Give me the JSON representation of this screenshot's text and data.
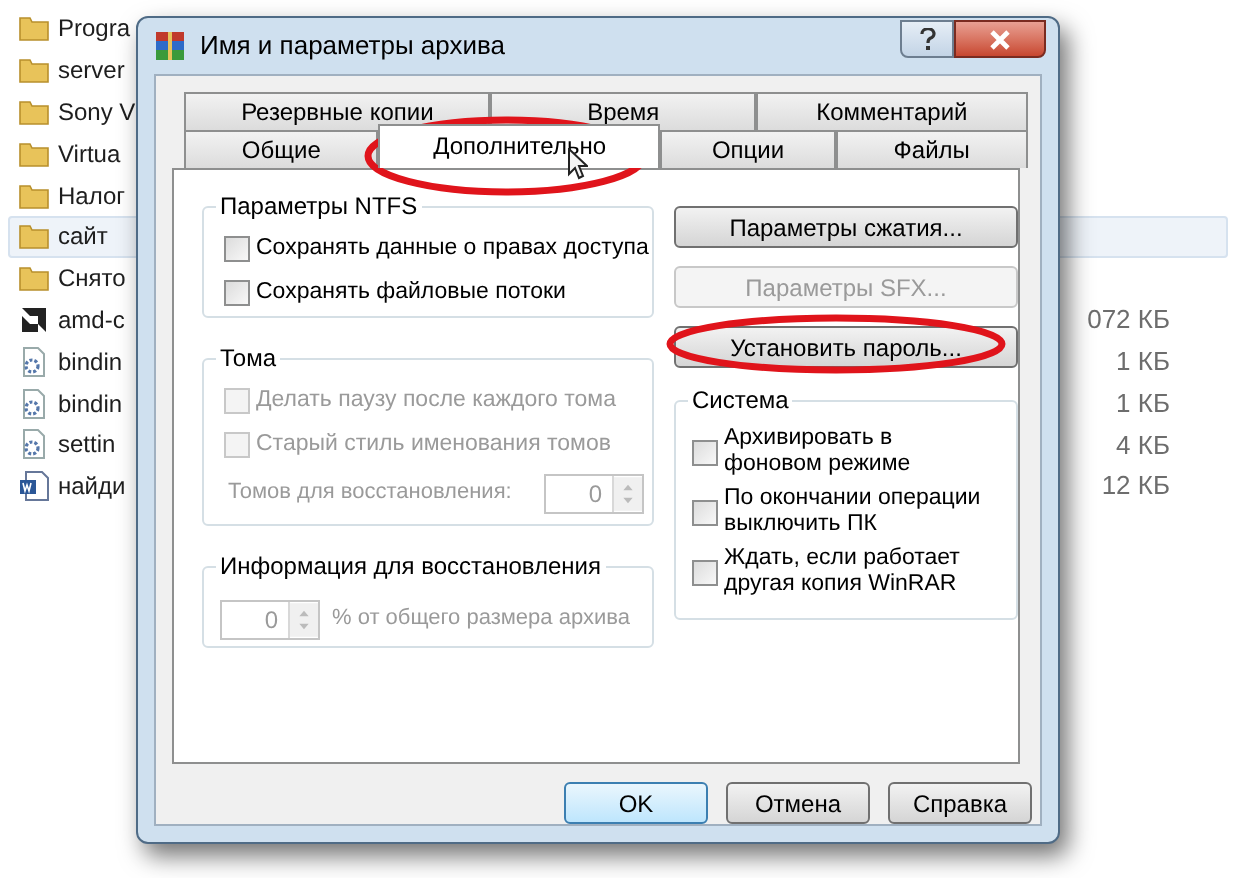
{
  "files": [
    {
      "name": "Progra",
      "kind": "folder",
      "selected": false
    },
    {
      "name": "server",
      "kind": "folder",
      "selected": false
    },
    {
      "name": "Sony V",
      "kind": "folder",
      "selected": false
    },
    {
      "name": "Virtua",
      "kind": "folder",
      "selected": false
    },
    {
      "name": "Налог",
      "kind": "folder",
      "selected": false
    },
    {
      "name": "сайт",
      "kind": "folder",
      "selected": true
    },
    {
      "name": "Снято",
      "kind": "folder",
      "selected": false
    },
    {
      "name": "amd-c",
      "kind": "app",
      "selected": false,
      "size": "072 КБ"
    },
    {
      "name": "bindin",
      "kind": "config",
      "selected": false,
      "size": "1 КБ"
    },
    {
      "name": "bindin",
      "kind": "config",
      "selected": false,
      "size": "1 КБ"
    },
    {
      "name": "settin",
      "kind": "config",
      "selected": false,
      "size": "4 КБ"
    },
    {
      "name": "найди",
      "kind": "doc",
      "selected": false,
      "size": "12 КБ"
    }
  ],
  "dialog": {
    "title": "Имя и параметры архива",
    "tabs_back": [
      {
        "label": "Резервные копии",
        "selected": false
      },
      {
        "label": "Время",
        "selected": false
      },
      {
        "label": "Комментарий",
        "selected": false
      }
    ],
    "tabs_front": [
      {
        "label": "Общие",
        "selected": false
      },
      {
        "label": "Дополнительно",
        "selected": true
      },
      {
        "label": "Опции",
        "selected": false
      },
      {
        "label": "Файлы",
        "selected": false
      }
    ],
    "ntfs": {
      "title": "Параметры NTFS",
      "options": [
        {
          "label": "Сохранять данные о правах доступа",
          "checked": false,
          "disabled": false
        },
        {
          "label": "Сохранять файловые потоки",
          "checked": false,
          "disabled": false
        }
      ]
    },
    "volumes": {
      "title": "Тома",
      "options": [
        {
          "label": "Делать паузу после каждого тома",
          "checked": false,
          "disabled": true
        },
        {
          "label": "Старый стиль именования томов",
          "checked": false,
          "disabled": true
        }
      ],
      "recovery_label": "Томов для восстановления:",
      "recovery_value": "0",
      "disabled": true
    },
    "recovery_info": {
      "title": "Информация для восстановления",
      "value": "0",
      "suffix": "% от общего размера архива",
      "disabled": true
    },
    "action_buttons": [
      {
        "label": "Параметры сжатия...",
        "disabled": false
      },
      {
        "label": "Параметры SFX...",
        "disabled": true
      },
      {
        "label": "Установить пароль...",
        "disabled": false
      }
    ],
    "system": {
      "title": "Система",
      "options": [
        {
          "label": "Архивировать в фоновом режиме",
          "checked": false
        },
        {
          "label": "По окончании операции выключить ПК",
          "checked": false
        },
        {
          "label": "Ждать, если работает другая копия WinRAR",
          "checked": false
        }
      ]
    },
    "footer_buttons": [
      {
        "label": "OK",
        "default": true
      },
      {
        "label": "Отмена",
        "default": false
      },
      {
        "label": "Справка",
        "default": false
      }
    ]
  }
}
